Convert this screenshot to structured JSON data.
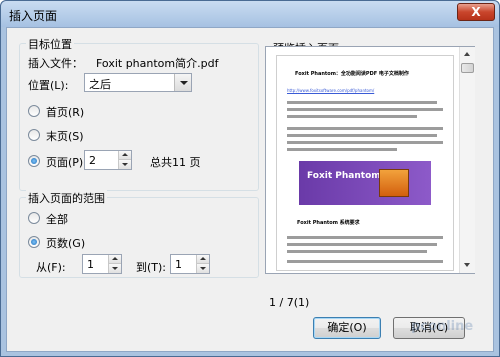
{
  "window": {
    "title": "插入页面",
    "close_glyph": "X"
  },
  "target": {
    "group_title": "目标位置",
    "file_label": "插入文件：",
    "file_name": "Foxit phantom简介.pdf",
    "position_label": "位置(L):",
    "position_value": "之后",
    "options": [
      {
        "label": "首页(R)",
        "checked": false
      },
      {
        "label": "末页(S)",
        "checked": false
      },
      {
        "label": "页面(P)",
        "checked": true
      }
    ],
    "page_value": "2",
    "total_pages": "总共11 页"
  },
  "range": {
    "group_title": "插入页面的范围",
    "options": [
      {
        "label": "全部",
        "checked": false
      },
      {
        "label": "页数(G)",
        "checked": true
      }
    ],
    "from_label": "从(F):",
    "from_value": "1",
    "to_label": "到(T):",
    "to_value": "1"
  },
  "preview": {
    "group_title": "预览插入页面",
    "page_indicator": "1 / 7(1)",
    "doc_heading": "Foxit Phantom：全功能阅读PDF 电子文档制作",
    "doc_link": "http://www.foxitsoftware.com/pdf/phantom/",
    "banner_text": "Foxit Phantom",
    "doc_section": "Foxit Phantom 系统要求"
  },
  "buttons": {
    "ok": "确定(O)",
    "cancel": "取消(C)"
  },
  "watermark": "pconline",
  "colors": {
    "accent_radio": "#1d6fbd",
    "frame_blue": "#aac3e0",
    "close_red": "#c9452c",
    "banner_purple": "#6a3aa8"
  }
}
